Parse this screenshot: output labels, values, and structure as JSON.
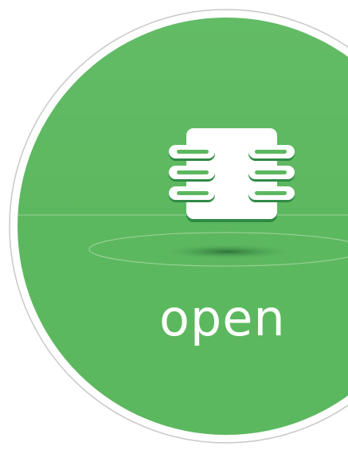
{
  "badge": {
    "label": "open",
    "icon": "hands-holding-chip-icon"
  },
  "colors": {
    "background": "#ffffff",
    "circle_fill": "#5cb85f",
    "circle_outline": "#c8c8c8",
    "icon_fill": "#ffffff",
    "icon_edge": "#2f8a45",
    "label_color": "#ffffff"
  }
}
